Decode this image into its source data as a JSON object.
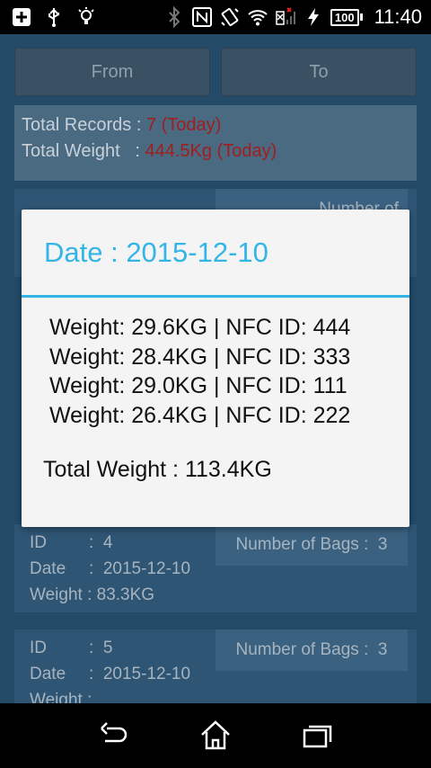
{
  "status_bar": {
    "battery": "100",
    "time": "11:40",
    "icons_left": [
      "add-box-icon",
      "usb-icon",
      "lightbulb-icon"
    ],
    "icons_right": [
      "bluetooth-icon",
      "nfc-icon",
      "vibrate-icon",
      "wifi-icon",
      "no-signal-icon",
      "charging-icon"
    ]
  },
  "toolbar": {
    "from_label": "From",
    "to_label": "To"
  },
  "summary": {
    "records_label": "Total Records :",
    "records_value": "7 (Today)",
    "weight_label": "Total Weight   :",
    "weight_value": "444.5Kg (Today)",
    "accent_color": "#a01e1e"
  },
  "records": [
    {
      "id_label": "ID",
      "id_sep": ":",
      "id": "4",
      "date_label": "Date",
      "date_sep": ":",
      "date": "2015-12-10",
      "weight_label": "Weight",
      "weight_sep": ":",
      "weight": "83.3KG",
      "bags_label": "Number of Bags :",
      "bags": "3"
    },
    {
      "id_label": "ID",
      "id_sep": ":",
      "id": "5",
      "date_label": "Date",
      "date_sep": ":",
      "date": "2015-12-10",
      "weight_label": "Weight",
      "weight_sep": ":",
      "weight": "",
      "bags_label": "Number of Bags :",
      "bags": "3"
    }
  ],
  "background_partial_text": "Number of",
  "dialog": {
    "title": "Date : 2015-12-10",
    "title_color": "#33b5e5",
    "entries": [
      "Weight: 29.6KG | NFC ID: 444",
      "Weight: 28.4KG | NFC ID: 333",
      "Weight: 29.0KG | NFC ID: 111",
      "Weight: 26.4KG | NFC ID: 222"
    ],
    "total": "Total Weight : 113.4KG"
  },
  "nav_bar": {
    "buttons": [
      "back-icon",
      "home-icon",
      "recent-apps-icon"
    ]
  }
}
